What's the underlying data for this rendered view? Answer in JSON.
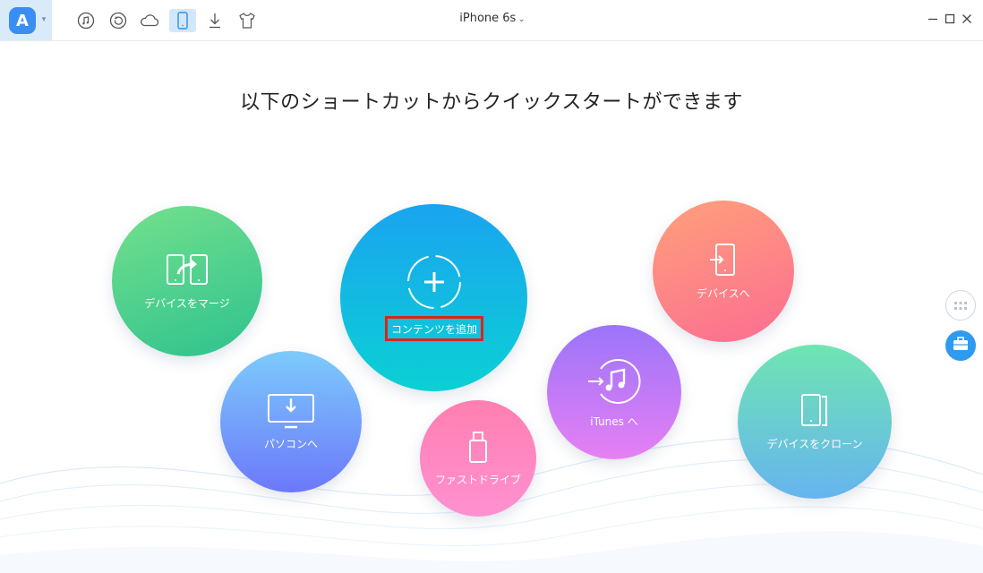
{
  "app": {
    "logo_letter": "A",
    "toolbar_icons": [
      "music-icon",
      "history-icon",
      "cloud-icon",
      "phone-icon",
      "download-icon",
      "tshirt-icon"
    ]
  },
  "device": {
    "name": "iPhone 6s"
  },
  "headline": "以下のショートカットからクイックスタートができます",
  "shortcuts": {
    "merge": "デバイスをマージ",
    "add_content": "コンテンツを追加",
    "to_device": "デバイスへ",
    "to_pc": "パソコンへ",
    "fast_drive": "ファストドライブ",
    "to_itunes": "iTunes へ",
    "clone": "デバイスをクローン"
  },
  "colors": {
    "accent": "#2e9bf0",
    "highlight_border": "#d9261c"
  }
}
